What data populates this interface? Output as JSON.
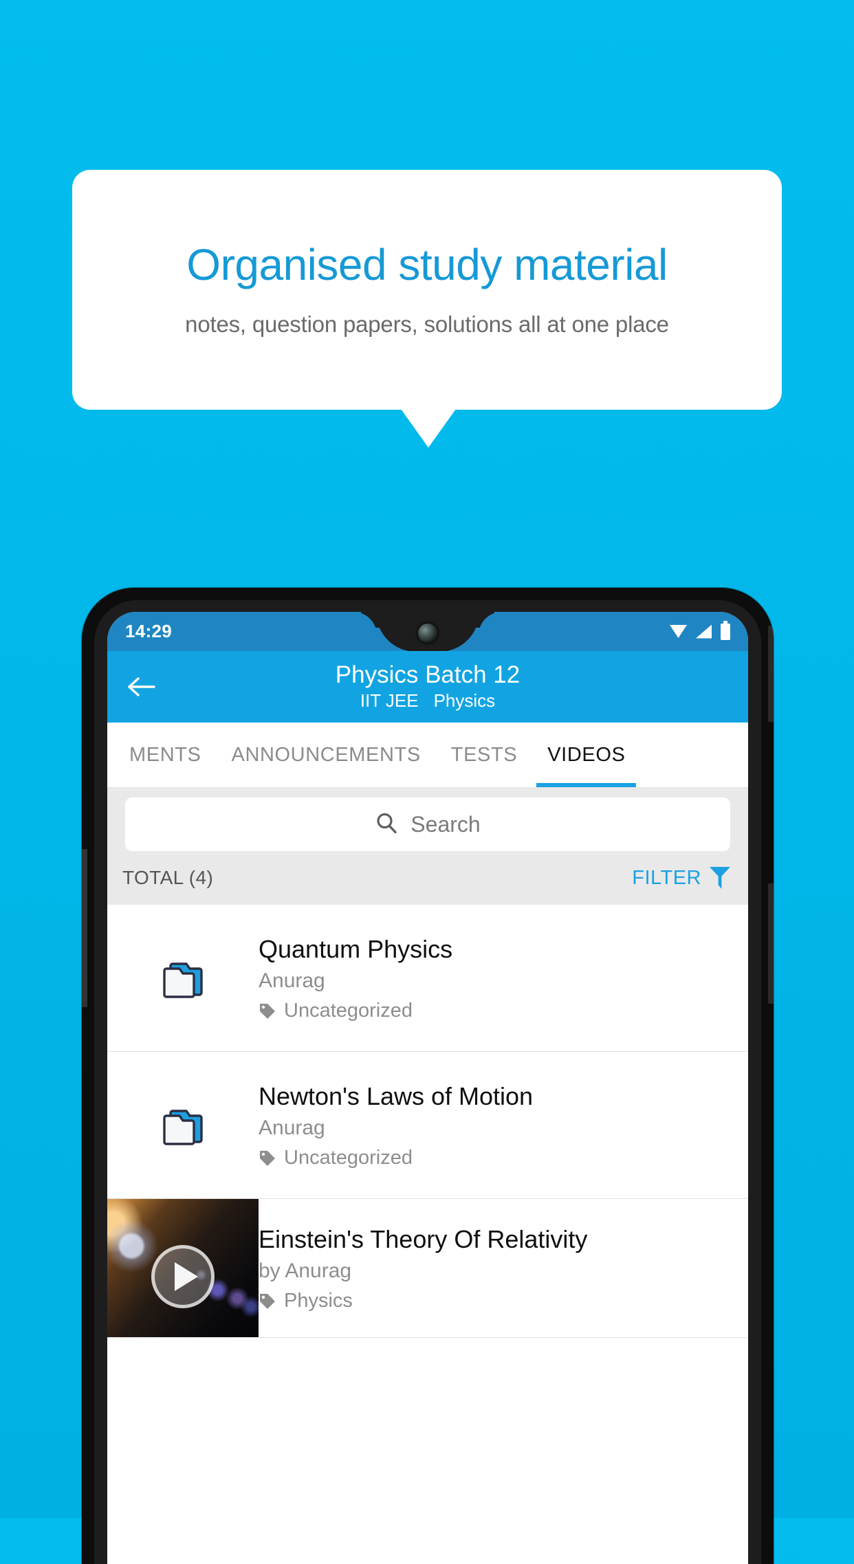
{
  "promo": {
    "title": "Organised study material",
    "subtitle": "notes, question papers, solutions all at one place"
  },
  "colors": {
    "background": "#03bdef",
    "accent": "#1ba1e2",
    "appbar": "#12a4e2",
    "statusbar": "#1f86c3",
    "promo_title": "#1699d6"
  },
  "phone": {
    "statusbar": {
      "time": "14:29",
      "icons": [
        "wifi-icon",
        "signal-icon",
        "battery-icon"
      ]
    },
    "appbar": {
      "back_icon": "back-arrow-icon",
      "title": "Physics Batch 12",
      "exam": "IIT JEE",
      "subject": "Physics"
    },
    "tabs": [
      {
        "label": "MENTS",
        "active": false
      },
      {
        "label": "ANNOUNCEMENTS",
        "active": false
      },
      {
        "label": "TESTS",
        "active": false
      },
      {
        "label": "VIDEOS",
        "active": true
      }
    ],
    "search": {
      "icon": "search-icon",
      "placeholder": "Search",
      "value": ""
    },
    "toolbar": {
      "total_label": "TOTAL (4)",
      "filter_label": "FILTER",
      "filter_icon": "filter-icon"
    },
    "list": [
      {
        "icon": "folder-icon",
        "title": "Quantum Physics",
        "author": "Anurag",
        "tag": "Uncategorized",
        "tag_icon": "tag-icon",
        "type": "folder"
      },
      {
        "icon": "folder-icon",
        "title": "Newton's Laws of Motion",
        "author": "Anurag",
        "tag": "Uncategorized",
        "tag_icon": "tag-icon",
        "type": "folder"
      },
      {
        "icon": "video-thumbnail",
        "title": "Einstein's Theory Of Relativity",
        "author": "by Anurag",
        "tag": "Physics",
        "tag_icon": "tag-icon",
        "play_icon": "play-icon",
        "type": "video"
      }
    ]
  }
}
